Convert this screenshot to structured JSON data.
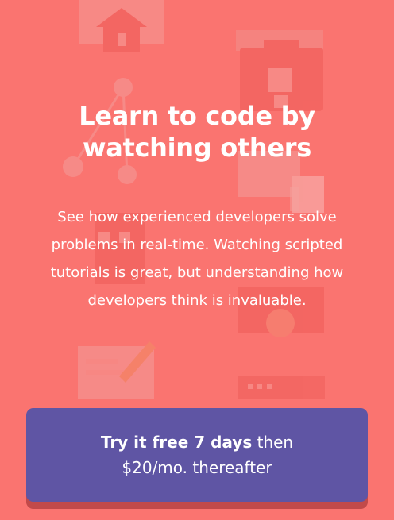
{
  "hero": {
    "title_line1": "Learn to code by",
    "title_line2": "watching others",
    "description": "See how experienced developers solve problems in real-time. Watching scripted tutorials is great, but understanding how developers think is invaluable."
  },
  "cta": {
    "emphasis": "Try it free 7 days",
    "rest_line1": " then",
    "line2": "$20/mo. thereafter"
  },
  "colors": {
    "background": "#fa7470",
    "cta_background": "#5f55a4",
    "cta_shadow": "#c24a4a",
    "text": "#ffffff"
  },
  "background_icons": [
    "house-icon",
    "briefcase-icon",
    "network-icon",
    "document-icon",
    "gear-icon",
    "pencil-icon",
    "browser-window-icon",
    "wrench-icon"
  ]
}
